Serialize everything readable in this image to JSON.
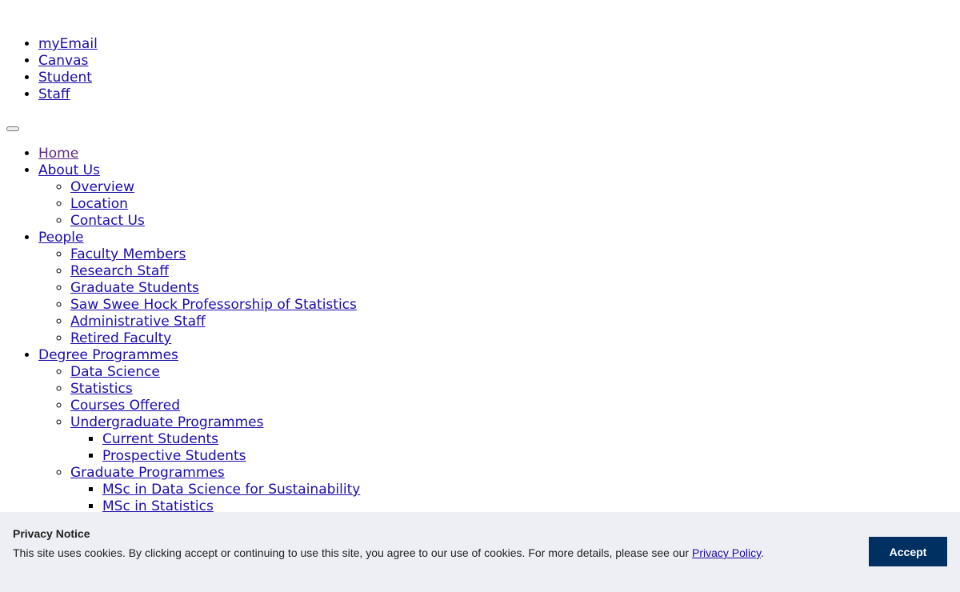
{
  "top_links": [
    "myEmail",
    "Canvas",
    "Student",
    "Staff"
  ],
  "menu_toggle_label": "",
  "nav": {
    "home": "Home",
    "about_us": {
      "label": "About Us",
      "children": [
        "Overview",
        "Location",
        "Contact Us"
      ]
    },
    "people": {
      "label": "People",
      "children": [
        "Faculty Members",
        "Research Staff",
        "Graduate Students",
        "Saw Swee Hock Professorship of Statistics",
        "Administrative Staff",
        "Retired Faculty"
      ]
    },
    "degree_programmes": {
      "label": "Degree Programmes",
      "children": [
        "Data Science",
        "Statistics",
        "Courses Offered"
      ],
      "undergraduate": {
        "label": "Undergraduate Programmes",
        "children": [
          "Current Students",
          "Prospective Students"
        ]
      },
      "graduate": {
        "label": "Graduate Programmes",
        "children": [
          "MSc in Data Science for Sustainability",
          "MSc in Statistics"
        ]
      }
    }
  },
  "privacy": {
    "title": "Privacy Notice",
    "text": "This site uses cookies. By clicking accept or continuing to use this site, you agree to our use of cookies. For more details, please see our ",
    "link": "Privacy Policy",
    "text_end": ".",
    "accept_label": "Accept"
  },
  "colors": {
    "link": "#1a0dab",
    "visited_link": "#5b2a86",
    "banner_bg": "#eeeff4",
    "accept_bg": "#003062"
  }
}
